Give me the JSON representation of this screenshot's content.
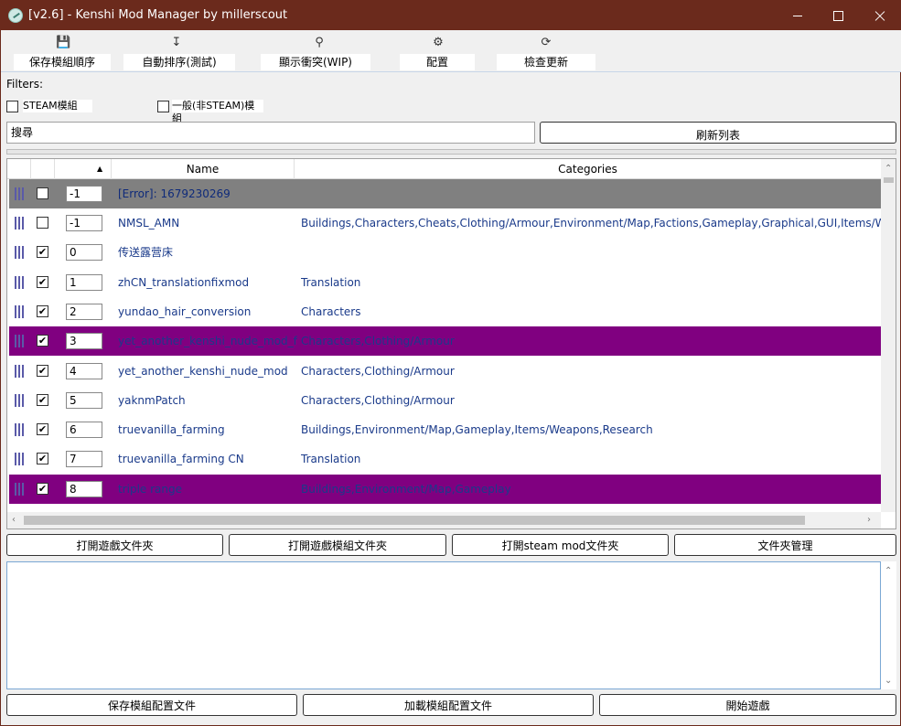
{
  "window": {
    "title": "[v2.6] - Kenshi Mod Manager by millerscout"
  },
  "toolbar": {
    "save_order": "保存模組順序",
    "auto_sort": "自動排序(測試)",
    "show_conflicts": "顯示衝突(WIP)",
    "config": "配置",
    "check_updates": "檢查更新"
  },
  "filters": {
    "label": "Filters:",
    "steam_mods": "STEAM模組",
    "non_steam_mods": "一般(非STEAM)模組"
  },
  "search": {
    "value": "搜尋",
    "refresh": "刷新列表"
  },
  "grid": {
    "columns": {
      "name": "Name",
      "categories": "Categories"
    },
    "rows": [
      {
        "order": "-1",
        "checked": false,
        "name": "[Error]: 1679230269",
        "categories": "",
        "style": "error"
      },
      {
        "order": "-1",
        "checked": false,
        "name": "NMSL_AMN",
        "categories": "Buildings,Characters,Cheats,Clothing/Armour,Environment/Map,Factions,Gameplay,Graphical,GUI,Items/Weapons",
        "style": "normal"
      },
      {
        "order": "0",
        "checked": true,
        "name": "传送露营床",
        "categories": "",
        "style": "normal"
      },
      {
        "order": "1",
        "checked": true,
        "name": "zhCN_translationfixmod",
        "categories": "Translation",
        "style": "normal"
      },
      {
        "order": "2",
        "checked": true,
        "name": "yundao_hair_conversion",
        "categories": "Characters",
        "style": "normal"
      },
      {
        "order": "3",
        "checked": true,
        "name": "yet_another_kenshi_nude_mod_fix",
        "categories": "Characters,Clothing/Armour",
        "style": "purple"
      },
      {
        "order": "4",
        "checked": true,
        "name": "yet_another_kenshi_nude_mod",
        "categories": "Characters,Clothing/Armour",
        "style": "normal"
      },
      {
        "order": "5",
        "checked": true,
        "name": "yaknmPatch",
        "categories": "Characters,Clothing/Armour",
        "style": "normal"
      },
      {
        "order": "6",
        "checked": true,
        "name": "truevanilla_farming",
        "categories": "Buildings,Environment/Map,Gameplay,Items/Weapons,Research",
        "style": "normal"
      },
      {
        "order": "7",
        "checked": true,
        "name": "truevanilla_farming CN",
        "categories": "Translation",
        "style": "normal"
      },
      {
        "order": "8",
        "checked": true,
        "name": "triple range",
        "categories": "Buildings,Environment/Map,Gameplay",
        "style": "purple"
      }
    ]
  },
  "folders": {
    "open_game": "打開遊戲文件夾",
    "open_game_mods": "打開遊戲模組文件夾",
    "open_steam_mods": "打開steam mod文件夾",
    "folder_manager": "文件夾管理"
  },
  "footer": {
    "save_profile": "保存模組配置文件",
    "load_profile": "加載模組配置文件",
    "start_game": "開始遊戲"
  },
  "icons": {
    "save": "save-icon",
    "sort": "sort-icon",
    "conflicts": "search-conflict-icon",
    "config": "gear-icon",
    "updates": "update-icon"
  }
}
